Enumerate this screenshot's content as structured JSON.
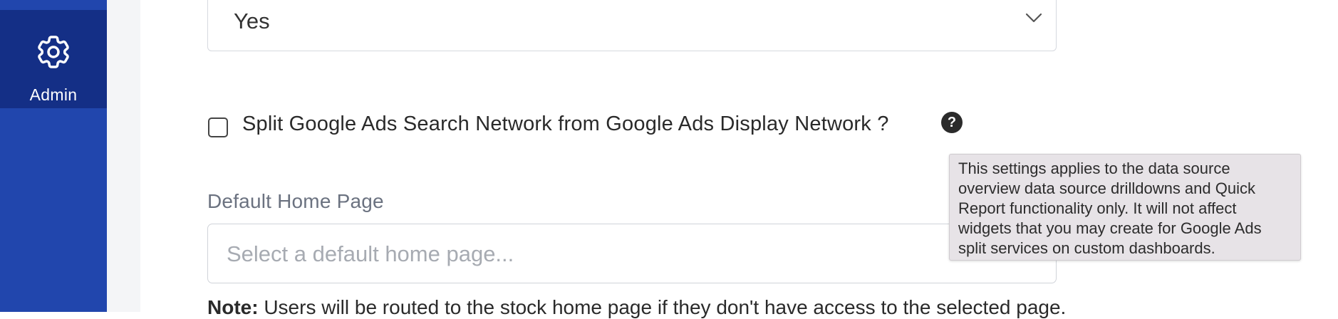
{
  "sidebar": {
    "active_item": {
      "label": "Admin",
      "icon": "gear-icon"
    },
    "colors": {
      "background": "#2146ad",
      "active": "#142f86"
    }
  },
  "form": {
    "top_select": {
      "value": "Yes"
    },
    "split_checkbox": {
      "label": "Split Google Ads Search Network from Google Ads Display Network ?",
      "checked": false,
      "help_glyph": "?"
    },
    "tooltip": {
      "text": "This settings applies to the data source overview data source drilldowns and Quick Report functionality only. It will not affect widgets that you may create for Google Ads split services on custom dashboards."
    },
    "default_home_page": {
      "label": "Default Home Page",
      "placeholder": "Select a default home page..."
    },
    "note": {
      "prefix": "Note:",
      "text": " Users will be routed to the stock home page if they don't have access to the selected page."
    }
  }
}
